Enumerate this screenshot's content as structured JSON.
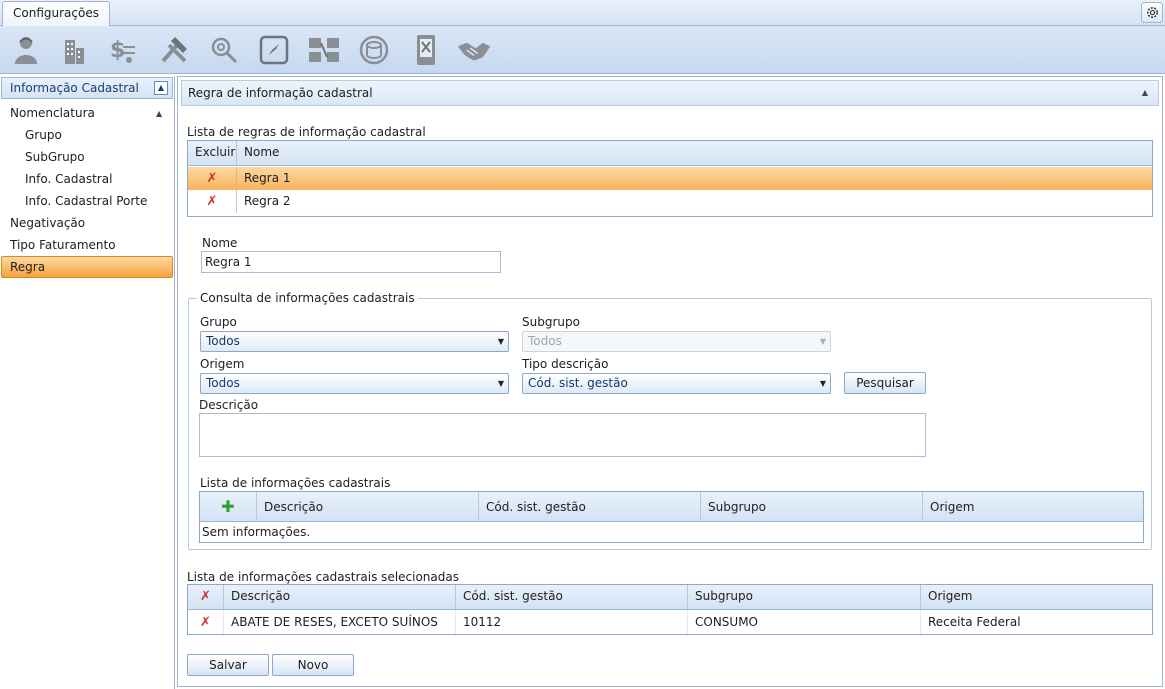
{
  "top_tab": {
    "label": "Configurações"
  },
  "ribbon": {
    "icons": [
      "user-icon",
      "building-icon",
      "money-scale-icon",
      "tools-icon",
      "search-settings-icon",
      "compass-icon",
      "document-flow-icon",
      "database-icon",
      "mobile-tools-icon",
      "handshake-icon"
    ]
  },
  "sidebar": {
    "header": "Informação Cadastral",
    "items": [
      {
        "label": "Nomenclatura",
        "level": 0
      },
      {
        "label": "Grupo",
        "level": 1
      },
      {
        "label": "SubGrupo",
        "level": 1
      },
      {
        "label": "Info. Cadastral",
        "level": 1
      },
      {
        "label": "Info. Cadastral Porte",
        "level": 1
      },
      {
        "label": "Negativação",
        "level": 0
      },
      {
        "label": "Tipo Faturamento",
        "level": 0
      },
      {
        "label": "Regra",
        "level": 0,
        "selected": true
      }
    ]
  },
  "panel": {
    "title": "Regra de informação cadastral",
    "rules_list": {
      "label": "Lista de regras de informação cadastral",
      "columns": [
        "Excluir",
        "Nome"
      ],
      "rows": [
        {
          "name": "Regra 1",
          "selected": true
        },
        {
          "name": "Regra 2",
          "selected": false
        }
      ]
    },
    "nome": {
      "label": "Nome",
      "value": "Regra 1"
    },
    "consulta": {
      "legend": "Consulta de informações cadastrais",
      "grupo": {
        "label": "Grupo",
        "value": "Todos"
      },
      "subgrupo": {
        "label": "Subgrupo",
        "value": "Todos"
      },
      "origem": {
        "label": "Origem",
        "value": "Todos"
      },
      "tipo_descricao": {
        "label": "Tipo descrição",
        "value": "Cód. sist. gestão"
      },
      "pesquisar": "Pesquisar",
      "descricao": {
        "label": "Descrição",
        "value": ""
      },
      "info_list": {
        "label": "Lista de informações cadastrais",
        "columns": [
          "Descrição",
          "Cód. sist. gestão",
          "Subgrupo",
          "Origem"
        ],
        "empty": "Sem informações."
      }
    },
    "selected_list": {
      "label": "Lista de informações cadastrais selecionadas",
      "columns": [
        "Descrição",
        "Cód. sist. gestão",
        "Subgrupo",
        "Origem"
      ],
      "rows": [
        {
          "descricao": "ABATE DE RESES, EXCETO SUÍNOS",
          "codigo": "10112",
          "subgrupo": "CONSUMO",
          "origem": "Receita Federal"
        }
      ]
    },
    "buttons": {
      "salvar": "Salvar",
      "novo": "Novo"
    }
  },
  "colors": {
    "accent": "#f5a23e",
    "header_blue": "#d3e2f4",
    "border": "#9eb6d4",
    "delete_red": "#d42a2a",
    "add_green": "#2e9e2e"
  }
}
